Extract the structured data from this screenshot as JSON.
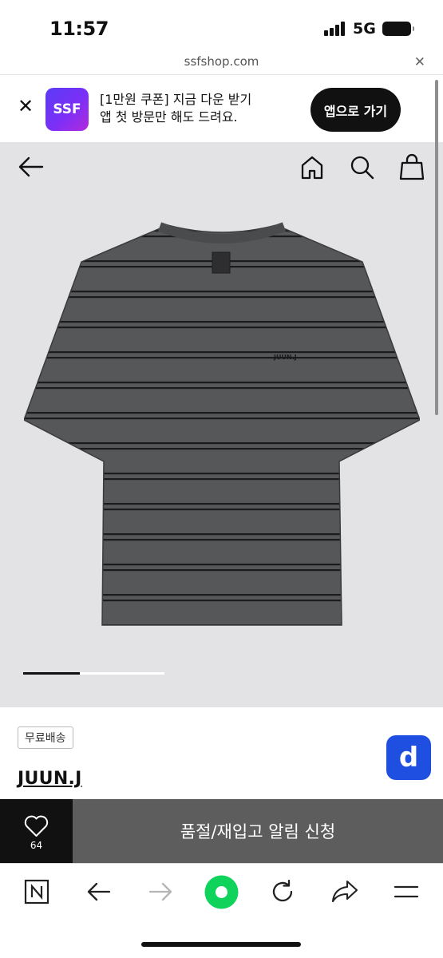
{
  "status_bar": {
    "time": "11:57",
    "network": "5G"
  },
  "url_bar": {
    "domain": "ssfshop.com"
  },
  "app_banner": {
    "logo_text": "SSF",
    "line1": "[1만원 쿠폰] 지금 다운 받기",
    "line2": "앱 첫 방문만 해도 드려요.",
    "cta_label": "앱으로 가기",
    "logo_gradient": [
      "#5b3cf5",
      "#b32bdc"
    ]
  },
  "product_nav": {
    "icons": [
      "back-arrow-icon",
      "home-icon",
      "search-icon",
      "shopping-bag-icon"
    ]
  },
  "gallery": {
    "current_image": 1,
    "progress_fraction": 0.4
  },
  "product": {
    "badge": "무료배송",
    "brand": "JUUN.J",
    "chest_logo": "JUUN.J"
  },
  "action_bar": {
    "wish_count": "64",
    "restock_label": "품절/재입고 알림 신청"
  },
  "floating_button": {
    "label": "d",
    "color": "#1f4fe0"
  },
  "browser_toolbar": {
    "icons": [
      "naver-n-icon",
      "back-icon",
      "forward-icon",
      "green-circle-icon",
      "reload-icon",
      "share-icon",
      "menu-icon"
    ]
  }
}
